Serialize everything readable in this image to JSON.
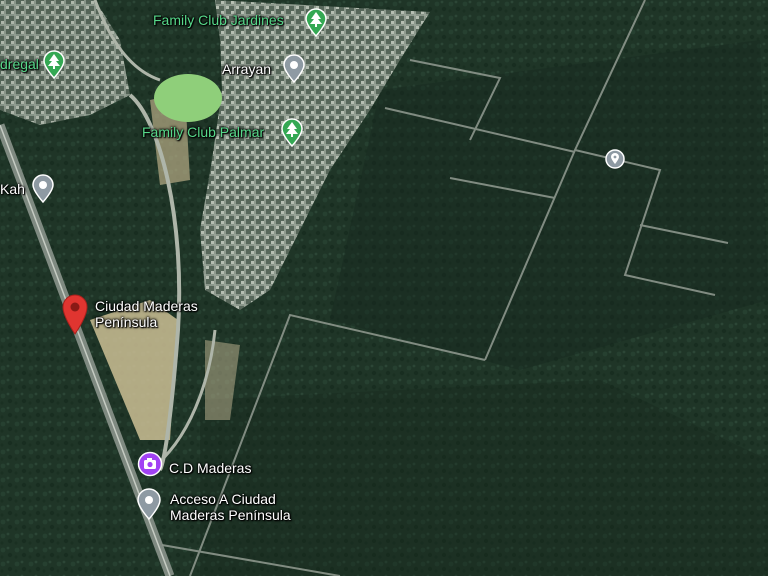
{
  "map": {
    "type": "satellite",
    "colors": {
      "forest": "#1f3527",
      "forest_dark": "#16281d",
      "road": "#9aa29a",
      "park_green": "#8fcf7a",
      "clearing": "#cdbf95",
      "residential": "#9aa59a",
      "pin_gray": "#8e9aa3",
      "pin_red": "#e03530",
      "park_icon_green": "#34a853",
      "photo_purple": "#a142f4"
    }
  },
  "places": {
    "family_club_jardines": {
      "label": "Family Club Jardines",
      "icon": "tree-icon"
    },
    "arrayan": {
      "label": "Arrayan",
      "icon": "location-pin-icon"
    },
    "family_club_palmar": {
      "label": "Family Club Palmar",
      "icon": "tree-icon"
    },
    "pedregal": {
      "label": "dregal",
      "icon": "tree-icon"
    },
    "kah": {
      "label": "Kah",
      "icon": "location-pin-icon"
    },
    "ciudad_maderas": {
      "label_line1": "Ciudad Maderas",
      "label_line2": "Península",
      "icon": "red-map-pin-icon"
    },
    "cd_maderas": {
      "label": "C.D Maderas",
      "icon": "camera-icon"
    },
    "acceso": {
      "label_line1": "Acceso A Ciudad",
      "label_line2": "Maderas Península",
      "icon": "location-pin-icon"
    },
    "unnamed_pin": {
      "icon": "location-pin-icon"
    }
  }
}
